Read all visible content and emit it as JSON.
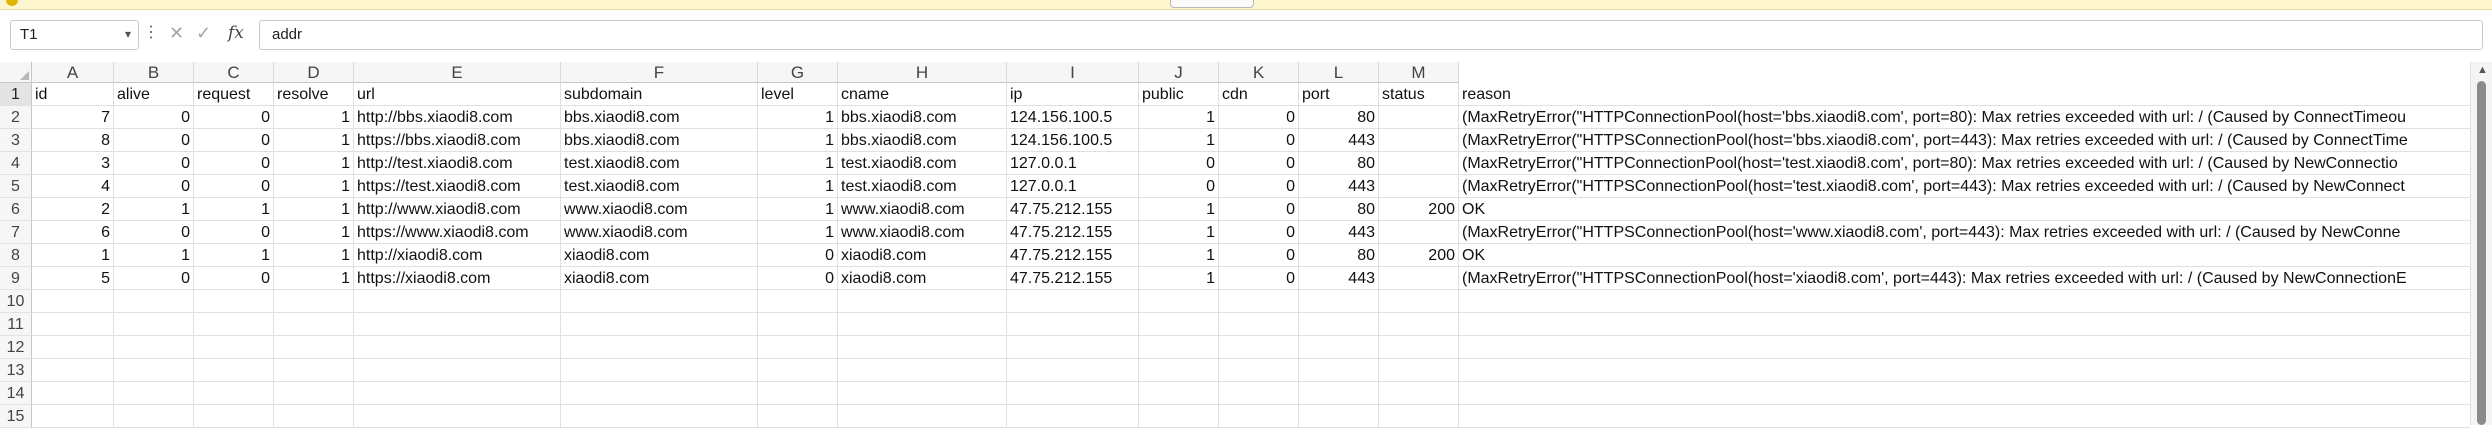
{
  "formula_bar": {
    "name_box": "T1",
    "cancel_icon": "✕",
    "enter_icon": "✓",
    "fx_label": "fx",
    "content": "addr"
  },
  "columns": [
    "A",
    "B",
    "C",
    "D",
    "E",
    "F",
    "G",
    "H",
    "I",
    "J",
    "K",
    "L",
    "M"
  ],
  "row_numbers": [
    "1",
    "2",
    "3",
    "4",
    "5",
    "6",
    "7",
    "8",
    "9",
    "10",
    "11",
    "12",
    "13",
    "14",
    "15"
  ],
  "headers": [
    "id",
    "alive",
    "request",
    "resolve",
    "url",
    "subdomain",
    "level",
    "cname",
    "ip",
    "public",
    "cdn",
    "port",
    "status",
    "reason"
  ],
  "rows": [
    [
      "7",
      "0",
      "0",
      "1",
      "http://bbs.xiaodi8.com",
      "bbs.xiaodi8.com",
      "1",
      "bbs.xiaodi8.com",
      "124.156.100.5",
      "1",
      "0",
      "80",
      "",
      "(MaxRetryError(\"HTTPConnectionPool(host='bbs.xiaodi8.com', port=80): Max retries exceeded with url: / (Caused by ConnectTimeou"
    ],
    [
      "8",
      "0",
      "0",
      "1",
      "https://bbs.xiaodi8.com",
      "bbs.xiaodi8.com",
      "1",
      "bbs.xiaodi8.com",
      "124.156.100.5",
      "1",
      "0",
      "443",
      "",
      "(MaxRetryError(\"HTTPSConnectionPool(host='bbs.xiaodi8.com', port=443): Max retries exceeded with url: / (Caused by ConnectTime"
    ],
    [
      "3",
      "0",
      "0",
      "1",
      "http://test.xiaodi8.com",
      "test.xiaodi8.com",
      "1",
      "test.xiaodi8.com",
      "127.0.0.1",
      "0",
      "0",
      "80",
      "",
      "(MaxRetryError(\"HTTPConnectionPool(host='test.xiaodi8.com', port=80): Max retries exceeded with url: / (Caused by NewConnectio"
    ],
    [
      "4",
      "0",
      "0",
      "1",
      "https://test.xiaodi8.com",
      "test.xiaodi8.com",
      "1",
      "test.xiaodi8.com",
      "127.0.0.1",
      "0",
      "0",
      "443",
      "",
      "(MaxRetryError(\"HTTPSConnectionPool(host='test.xiaodi8.com', port=443): Max retries exceeded with url: / (Caused by NewConnect"
    ],
    [
      "2",
      "1",
      "1",
      "1",
      "http://www.xiaodi8.com",
      "www.xiaodi8.com",
      "1",
      "www.xiaodi8.com",
      "47.75.212.155",
      "1",
      "0",
      "80",
      "200",
      "OK"
    ],
    [
      "6",
      "0",
      "0",
      "1",
      "https://www.xiaodi8.com",
      "www.xiaodi8.com",
      "1",
      "www.xiaodi8.com",
      "47.75.212.155",
      "1",
      "0",
      "443",
      "",
      "(MaxRetryError(\"HTTPSConnectionPool(host='www.xiaodi8.com', port=443): Max retries exceeded with url: / (Caused by NewConne"
    ],
    [
      "1",
      "1",
      "1",
      "1",
      "http://xiaodi8.com",
      "xiaodi8.com",
      "0",
      "xiaodi8.com",
      "47.75.212.155",
      "1",
      "0",
      "80",
      "200",
      "OK"
    ],
    [
      "5",
      "0",
      "0",
      "1",
      "https://xiaodi8.com",
      "xiaodi8.com",
      "0",
      "xiaodi8.com",
      "47.75.212.155",
      "1",
      "0",
      "443",
      "",
      "(MaxRetryError(\"HTTPSConnectionPool(host='xiaodi8.com', port=443): Max retries exceeded with url: / (Caused by NewConnectionE"
    ]
  ]
}
